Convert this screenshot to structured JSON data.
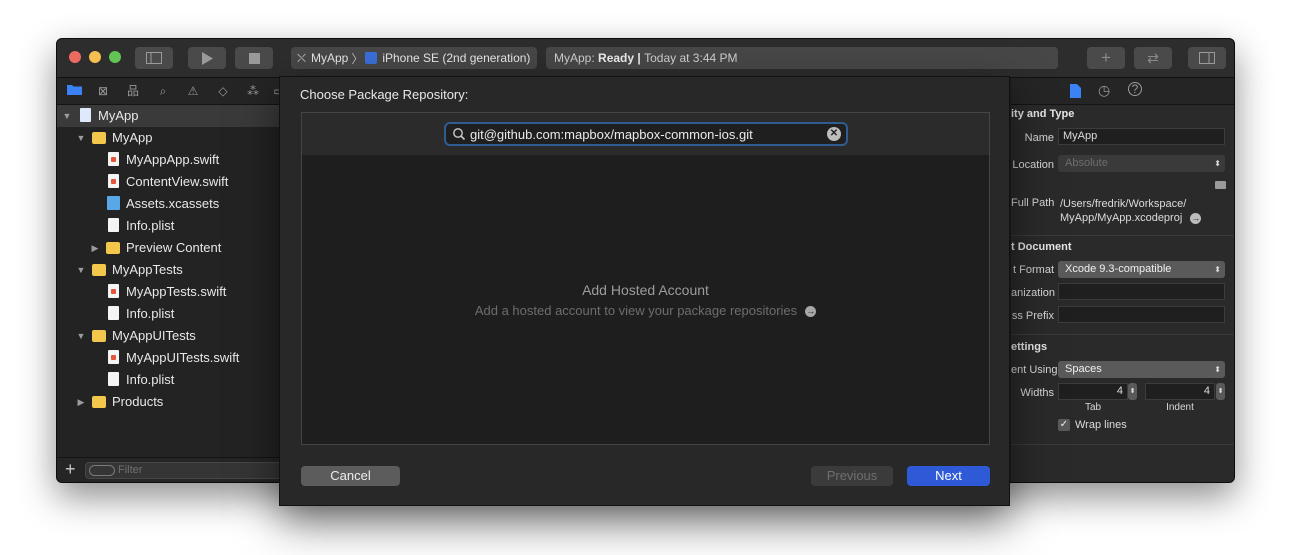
{
  "window": {
    "scheme": {
      "target": "MyApp",
      "separator": "〉",
      "device": "iPhone SE (2nd generation)"
    },
    "activity": {
      "project": "MyApp:",
      "status": "Ready",
      "divider": "|",
      "time": "Today at 3:44 PM"
    },
    "colors": {
      "accent": "#2f5ad7",
      "close": "#ec6a5f",
      "minimize": "#f4bf4f",
      "zoom": "#61c454",
      "folder": "#f2c74c"
    }
  },
  "navigator": {
    "tree": [
      {
        "label": "MyApp",
        "kind": "project",
        "expanded": true,
        "selected": true
      },
      {
        "label": "MyApp",
        "kind": "folder",
        "expanded": true
      },
      {
        "label": "MyAppApp.swift",
        "kind": "swift"
      },
      {
        "label": "ContentView.swift",
        "kind": "swift"
      },
      {
        "label": "Assets.xcassets",
        "kind": "assets"
      },
      {
        "label": "Info.plist",
        "kind": "plist"
      },
      {
        "label": "Preview Content",
        "kind": "folder",
        "expanded": false
      },
      {
        "label": "MyAppTests",
        "kind": "folder",
        "expanded": true
      },
      {
        "label": "MyAppTests.swift",
        "kind": "swift"
      },
      {
        "label": "Info.plist",
        "kind": "plist"
      },
      {
        "label": "MyAppUITests",
        "kind": "folder",
        "expanded": true
      },
      {
        "label": "MyAppUITests.swift",
        "kind": "swift"
      },
      {
        "label": "Info.plist",
        "kind": "plist"
      },
      {
        "label": "Products",
        "kind": "folder",
        "expanded": false
      }
    ],
    "filter_placeholder": "Filter",
    "add_label": "+"
  },
  "inspector": {
    "identity_header": "ity and Type",
    "name_label": "Name",
    "name_value": "MyApp",
    "location_label": "Location",
    "location_value": "Absolute",
    "fullpath_label": "Full Path",
    "fullpath_line1": "/Users/fredrik/Workspace/",
    "fullpath_line2": "MyApp/MyApp.xcodeproj",
    "document_header": "t Document",
    "format_label": "t Format",
    "format_value": "Xcode 9.3-compatible",
    "organization_label": "anization",
    "prefix_label": "ss Prefix",
    "text_header": "ettings",
    "indent_using_label": "ent Using",
    "indent_using_value": "Spaces",
    "widths_label": "Widths",
    "tab_value": "4",
    "indent_value": "4",
    "tab_label": "Tab",
    "indent_label": "Indent",
    "wrap_label": "Wrap lines",
    "wrap_checked": true
  },
  "sheet": {
    "title": "Choose Package Repository:",
    "search_value": "git@github.com:mapbox/mapbox-common-ios.git",
    "empty_title": "Add Hosted Account",
    "empty_subtitle": "Add a hosted account to view your package repositories",
    "cancel_label": "Cancel",
    "previous_label": "Previous",
    "next_label": "Next"
  }
}
